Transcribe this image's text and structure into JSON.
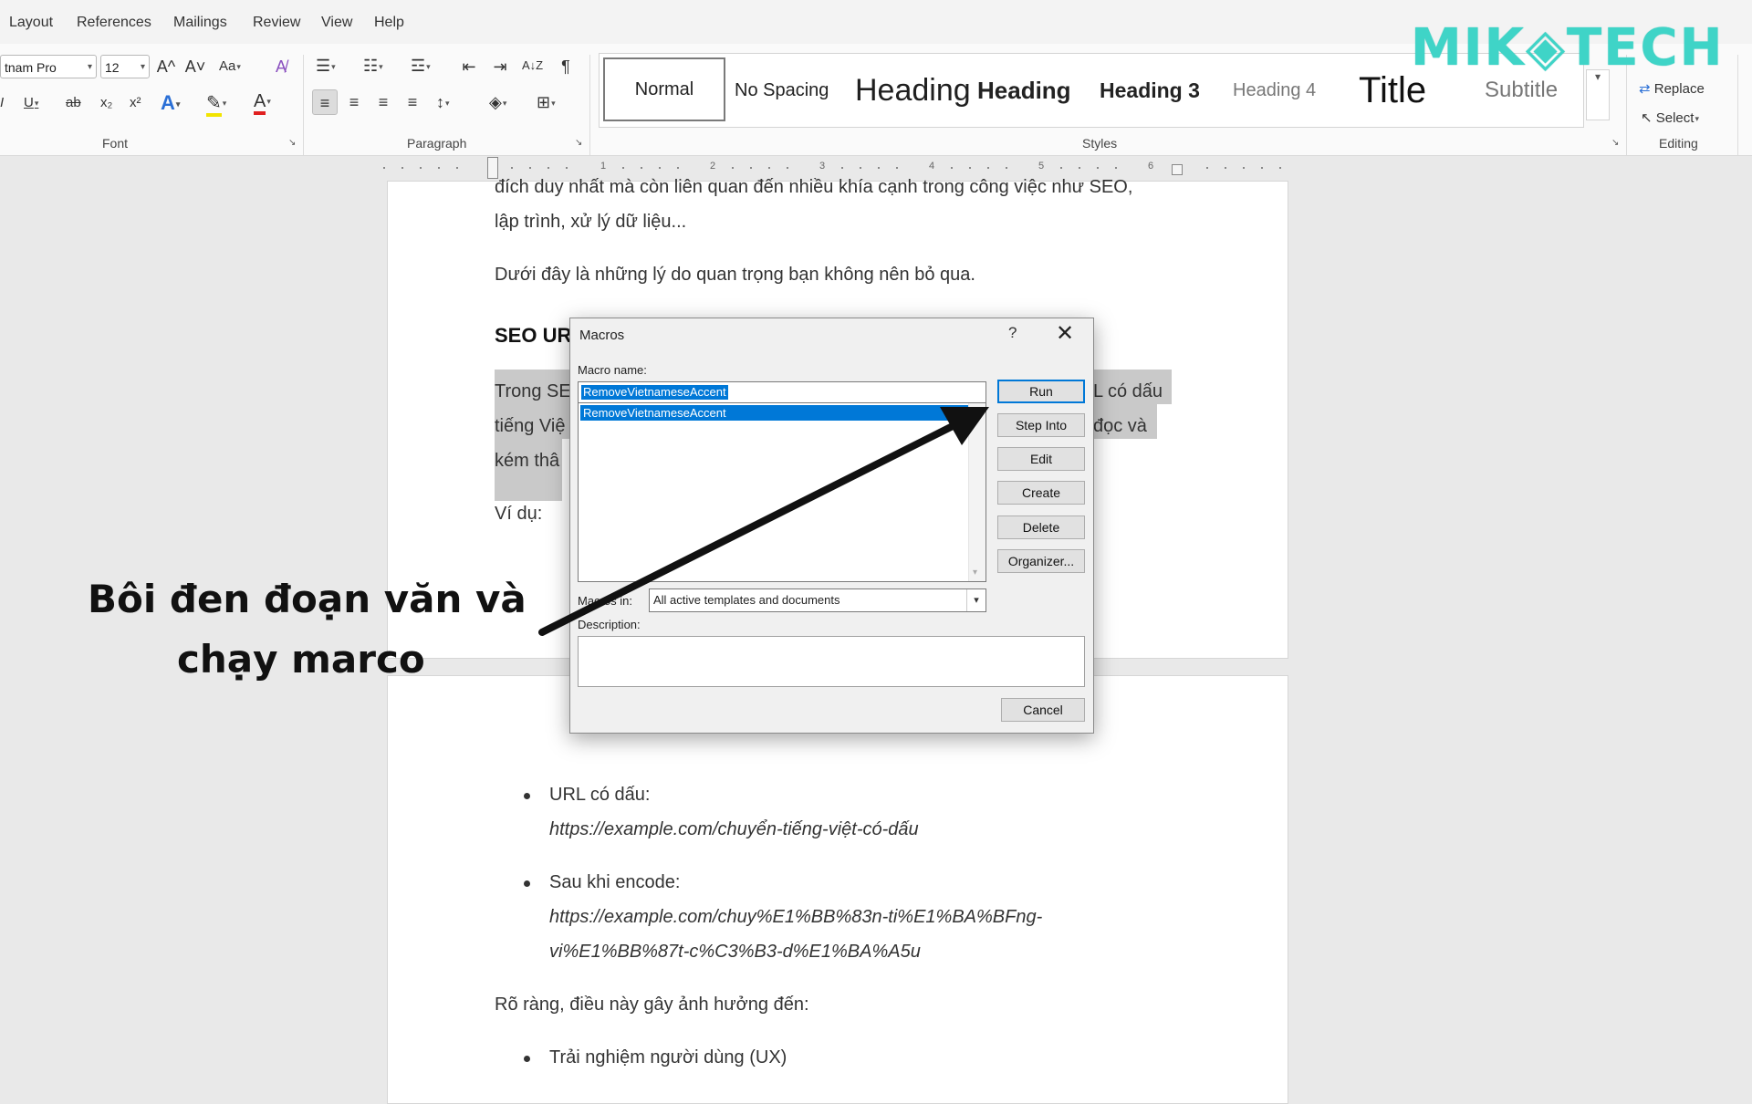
{
  "menu": [
    "Layout",
    "References",
    "Mailings",
    "Review",
    "View",
    "Help"
  ],
  "ribbon": {
    "font": {
      "label": "Font",
      "family": "tnam Pro",
      "size": "12",
      "grow": "A^",
      "shrink": "A˅",
      "case": "Aa",
      "underline": "U",
      "strike": "ab",
      "subscript": "x₂",
      "superscript": "x²",
      "italic": "I",
      "effects": "A",
      "color": "A"
    },
    "paragraph": {
      "label": "Paragraph",
      "sort": "A↓Z",
      "pilcrow": "¶"
    },
    "styles": {
      "label": "Styles",
      "items": [
        "Normal",
        "No Spacing",
        "Heading",
        "Heading",
        "Heading 3",
        "Heading 4",
        "Title",
        "Subtitle"
      ]
    },
    "editing": {
      "label": "Editing",
      "replace": "Replace",
      "select": "Select"
    }
  },
  "logo": {
    "text": "MIK◈TECH",
    "color": "#3fd4c7"
  },
  "ruler": {
    "numbers": [
      "1",
      "2",
      "3",
      "4",
      "5",
      "6"
    ]
  },
  "document": {
    "line1": "đích duy nhất mà còn liên quan đến nhiều khía cạnh trong công việc như SEO,",
    "line2": "lập trình, xử lý dữ liệu...",
    "line3": "Dưới đây là những lý do quan trọng bạn không nên bỏ qua.",
    "heading": "SEO UR",
    "hl1_left": "Trong SE",
    "hl1_right": "L có dấu",
    "hl2_left": "tiếng Việ",
    "hl2_right": "đọc và",
    "hl3_left": "kém thâ",
    "example": "Ví dụ:",
    "b1_label": "URL có dấu:",
    "b1_url": "https://example.com/chuyển-tiếng-việt-có-dấu",
    "b2_label": "Sau khi encode:",
    "b2_url1": "https://example.com/chuy%E1%BB%83n-ti%E1%BA%BFng-",
    "b2_url2": "vi%E1%BB%87t-c%C3%B3-d%E1%BA%A5u",
    "conclusion": "Rõ ràng, điều này gây ảnh hưởng đến:",
    "b3": "Trải nghiệm người dùng (UX)"
  },
  "annotation": {
    "line1": "Bôi đen đoạn văn và",
    "line2": "chạy marco"
  },
  "dialog": {
    "title": "Macros",
    "help": "?",
    "close": "✕",
    "macro_name_label": "Macro name:",
    "macro_name_value": "RemoveVietnameseAccent",
    "list": [
      "RemoveVietnameseAccent"
    ],
    "buttons": [
      "Run",
      "Step Into",
      "Edit",
      "Create",
      "Delete",
      "Organizer..."
    ],
    "macros_in_label": "Macros in:",
    "macros_in_value": "All active templates and documents",
    "description_label": "Description:",
    "cancel": "Cancel"
  }
}
